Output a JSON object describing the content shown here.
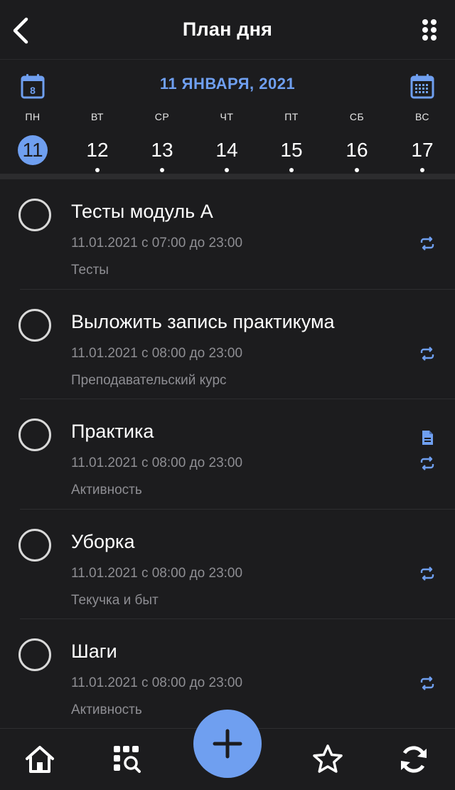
{
  "header": {
    "title": "План дня",
    "back_icon": "chevron-left-icon",
    "menu_icon": "dots-grid-icon"
  },
  "date_panel": {
    "current_date": "11 ЯНВАРЯ, 2021",
    "today_badge": "8",
    "week": [
      {
        "abbr": "ПН",
        "num": "11",
        "selected": true
      },
      {
        "abbr": "ВТ",
        "num": "12",
        "selected": false
      },
      {
        "abbr": "СР",
        "num": "13",
        "selected": false
      },
      {
        "abbr": "ЧТ",
        "num": "14",
        "selected": false
      },
      {
        "abbr": "ПТ",
        "num": "15",
        "selected": false
      },
      {
        "abbr": "СБ",
        "num": "16",
        "selected": false
      },
      {
        "abbr": "ВС",
        "num": "17",
        "selected": false
      }
    ]
  },
  "tasks": [
    {
      "title": "Тесты модуль А",
      "time": "11.01.2021 с 07:00 до 23:00",
      "category": "Тесты",
      "has_note": false,
      "repeat": true
    },
    {
      "title": "Выложить запись практикума",
      "time": "11.01.2021 с 08:00 до 23:00",
      "category": "Преподавательский курс",
      "has_note": false,
      "repeat": true
    },
    {
      "title": "Практика",
      "time": "11.01.2021 с 08:00 до 23:00",
      "category": "Активность",
      "has_note": true,
      "repeat": true
    },
    {
      "title": "Уборка",
      "time": "11.01.2021 с 08:00 до 23:00",
      "category": "Текучка и быт",
      "has_note": false,
      "repeat": true
    },
    {
      "title": "Шаги",
      "time": "11.01.2021 с 08:00 до 23:00",
      "category": "Активность",
      "has_note": false,
      "repeat": true
    }
  ],
  "bottom_nav": {
    "items": [
      "home-icon",
      "catalog-search-icon",
      "add-icon",
      "star-icon",
      "sync-icon"
    ]
  },
  "colors": {
    "accent": "#6f9ff0",
    "background": "#1c1c1e",
    "muted_text": "#8e8e93"
  }
}
